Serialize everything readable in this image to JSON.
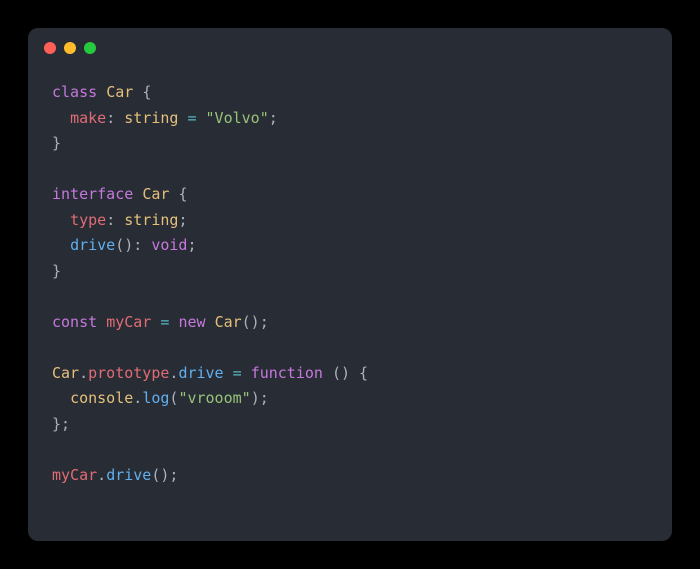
{
  "window": {
    "traffic_lights": {
      "close_color": "#ff5f56",
      "minimize_color": "#ffbd2e",
      "zoom_color": "#27c93f"
    }
  },
  "code": {
    "lines": [
      {
        "tokens": [
          {
            "t": "class ",
            "c": "kw"
          },
          {
            "t": "Car ",
            "c": "cls"
          },
          {
            "t": "{",
            "c": "punct"
          }
        ]
      },
      {
        "tokens": [
          {
            "t": "  ",
            "c": "punct"
          },
          {
            "t": "make",
            "c": "ident"
          },
          {
            "t": ": ",
            "c": "punct"
          },
          {
            "t": "string",
            "c": "type"
          },
          {
            "t": " ",
            "c": "punct"
          },
          {
            "t": "=",
            "c": "op"
          },
          {
            "t": " ",
            "c": "punct"
          },
          {
            "t": "\"Volvo\"",
            "c": "str"
          },
          {
            "t": ";",
            "c": "punct"
          }
        ]
      },
      {
        "tokens": [
          {
            "t": "}",
            "c": "punct"
          }
        ]
      },
      {
        "tokens": []
      },
      {
        "tokens": [
          {
            "t": "interface ",
            "c": "kw"
          },
          {
            "t": "Car ",
            "c": "cls"
          },
          {
            "t": "{",
            "c": "punct"
          }
        ]
      },
      {
        "tokens": [
          {
            "t": "  ",
            "c": "punct"
          },
          {
            "t": "type",
            "c": "ident"
          },
          {
            "t": ": ",
            "c": "punct"
          },
          {
            "t": "string",
            "c": "type"
          },
          {
            "t": ";",
            "c": "punct"
          }
        ]
      },
      {
        "tokens": [
          {
            "t": "  ",
            "c": "punct"
          },
          {
            "t": "drive",
            "c": "fn"
          },
          {
            "t": "(): ",
            "c": "punct"
          },
          {
            "t": "void",
            "c": "kw"
          },
          {
            "t": ";",
            "c": "punct"
          }
        ]
      },
      {
        "tokens": [
          {
            "t": "}",
            "c": "punct"
          }
        ]
      },
      {
        "tokens": []
      },
      {
        "tokens": [
          {
            "t": "const ",
            "c": "kw"
          },
          {
            "t": "myCar",
            "c": "var"
          },
          {
            "t": " ",
            "c": "punct"
          },
          {
            "t": "=",
            "c": "op"
          },
          {
            "t": " ",
            "c": "punct"
          },
          {
            "t": "new ",
            "c": "kw"
          },
          {
            "t": "Car",
            "c": "cls"
          },
          {
            "t": "();",
            "c": "punct"
          }
        ]
      },
      {
        "tokens": []
      },
      {
        "tokens": [
          {
            "t": "Car",
            "c": "cls"
          },
          {
            "t": ".",
            "c": "punct"
          },
          {
            "t": "prototype",
            "c": "proto"
          },
          {
            "t": ".",
            "c": "punct"
          },
          {
            "t": "drive",
            "c": "fn"
          },
          {
            "t": " ",
            "c": "punct"
          },
          {
            "t": "=",
            "c": "op"
          },
          {
            "t": " ",
            "c": "punct"
          },
          {
            "t": "function ",
            "c": "kw"
          },
          {
            "t": "() {",
            "c": "punct"
          }
        ]
      },
      {
        "tokens": [
          {
            "t": "  ",
            "c": "punct"
          },
          {
            "t": "console",
            "c": "obj"
          },
          {
            "t": ".",
            "c": "punct"
          },
          {
            "t": "log",
            "c": "fn"
          },
          {
            "t": "(",
            "c": "punct"
          },
          {
            "t": "\"vrooom\"",
            "c": "str"
          },
          {
            "t": ");",
            "c": "punct"
          }
        ]
      },
      {
        "tokens": [
          {
            "t": "};",
            "c": "punct"
          }
        ]
      },
      {
        "tokens": []
      },
      {
        "tokens": [
          {
            "t": "myCar",
            "c": "var"
          },
          {
            "t": ".",
            "c": "punct"
          },
          {
            "t": "drive",
            "c": "fn"
          },
          {
            "t": "();",
            "c": "punct"
          }
        ]
      }
    ]
  }
}
